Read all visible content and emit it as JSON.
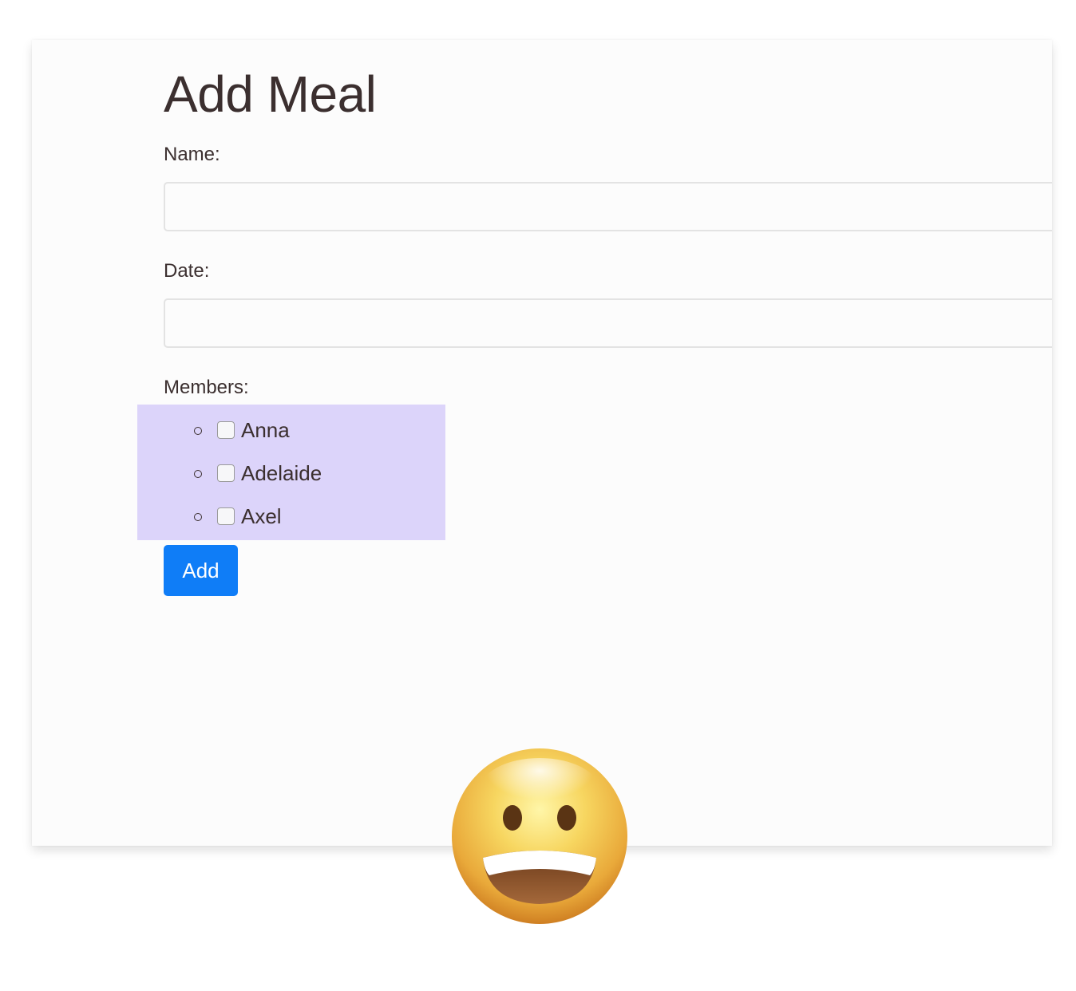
{
  "form": {
    "title": "Add Meal",
    "name_label": "Name:",
    "name_value": "",
    "date_label": "Date:",
    "date_value": "",
    "members_label": "Members:",
    "members": [
      {
        "name": "Anna",
        "checked": false
      },
      {
        "name": "Adelaide",
        "checked": false
      },
      {
        "name": "Axel",
        "checked": false
      }
    ],
    "add_label": "Add"
  },
  "colors": {
    "accent": "#0f7df7",
    "members_highlight": "#dcd4fa",
    "text": "#3b2f2f"
  },
  "icons": {
    "overlay": "grinning-face-emoji"
  }
}
